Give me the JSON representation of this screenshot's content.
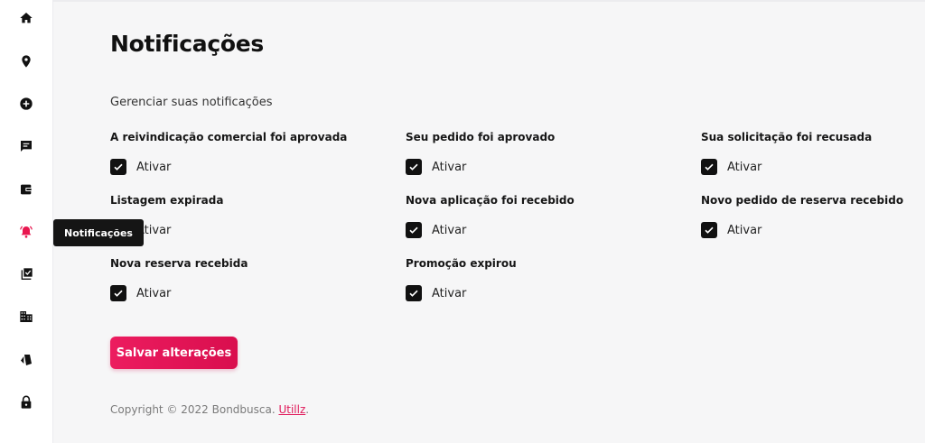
{
  "sidebar": {
    "items": [
      {
        "icon": "home-icon"
      },
      {
        "icon": "location-pin-icon"
      },
      {
        "icon": "add-circle-icon"
      },
      {
        "icon": "chat-icon"
      },
      {
        "icon": "wallet-icon"
      },
      {
        "icon": "bell-alert-icon",
        "active": true,
        "tooltip": "Notificações"
      },
      {
        "icon": "checklist-icon"
      },
      {
        "icon": "buildings-icon"
      },
      {
        "icon": "tag-icon"
      },
      {
        "icon": "lock-icon"
      }
    ]
  },
  "page": {
    "title": "Notificações",
    "subtitle": "Gerenciar suas notificações"
  },
  "options": [
    {
      "label": "A reivindicação comercial foi aprovada",
      "check_label": "Ativar",
      "checked": true
    },
    {
      "label": "Seu pedido foi aprovado",
      "check_label": "Ativar",
      "checked": true
    },
    {
      "label": "Sua solicitação foi recusada",
      "check_label": "Ativar",
      "checked": true
    },
    {
      "label": "Listagem expirada",
      "check_label": "Ativar",
      "checked": true
    },
    {
      "label": "Nova aplicação foi recebido",
      "check_label": "Ativar",
      "checked": true
    },
    {
      "label": "Novo pedido de reserva recebido",
      "check_label": "Ativar",
      "checked": true
    },
    {
      "label": "Nova reserva recebida",
      "check_label": "Ativar",
      "checked": true
    },
    {
      "label": "Promoção expirou",
      "check_label": "Ativar",
      "checked": true
    }
  ],
  "actions": {
    "save_label": "Salvar alterações"
  },
  "footer": {
    "text": "Copyright © 2022 Bondbusca. ",
    "link": "Utillz",
    "suffix": "."
  },
  "colors": {
    "accent": "#e0195a",
    "active_icon": "#e8174f",
    "checkbox": "#111111"
  }
}
